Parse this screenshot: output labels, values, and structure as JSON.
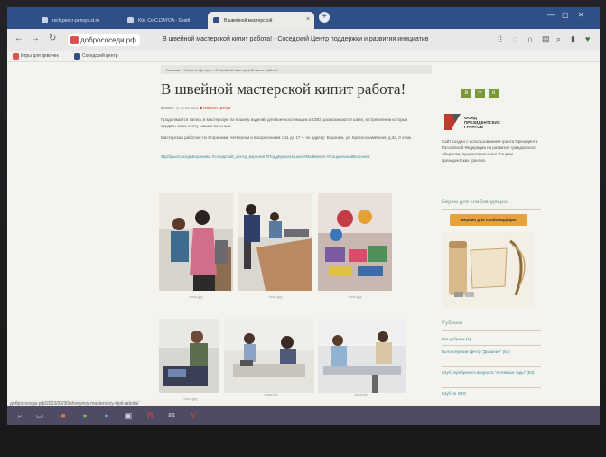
{
  "browser": {
    "tabs": [
      {
        "label": "rsch.peecr-pensys.st.ru"
      },
      {
        "label": "Kto. Co.C.DAYOA - Seattl"
      },
      {
        "label": "В швейной мастерской"
      }
    ],
    "address_chip": "добрососеди.рф",
    "page_heading": "В швейной мастерской кипит работа! - Соседский Центр поддержки и развития инициатив",
    "bookmarks": [
      {
        "label": "Игры для девочек"
      },
      {
        "label": "Соседский центр"
      }
    ]
  },
  "page": {
    "breadcrumb": "Главная » Новости Центра » В швейной мастерской кипит работа!",
    "title": "В швейной мастерской кипит работа!",
    "meta": {
      "author": "admin",
      "date": "30.03.2023",
      "category": "Новости Центра"
    },
    "paragraphs": [
      "Продолжается запись в мастерскую по пошиву изделий для военнослужащих в СВО, разыскиваются швеи, в стремлении которых придать свою лепту нашим военным.",
      "Мастерская работает по вторникам, четвергам и воскресеньям с 11 до 17 ч. по адресу: Воронеж, ул. Краснознамённая, д.3а, 3 этаж."
    ],
    "hashtags": "#ДобрыеСоседиВоронежа #соседский_центр_воронеж #ПоддержкаНаших #МыВместе #СоциальныйВоронеж",
    "photo_caption": "docs.jpg"
  },
  "sidebar": {
    "fund_name": "ФОНД ПРЕЗИДЕНТСКИХ ГРАНТОВ",
    "fund_text": "Сайт создан с использованием гранта Президента Российской Федерации на развитие гражданского общества, предоставленного Фондом президентских грантов.",
    "volunteer_heading": "Берем для слабовидящих",
    "volunteer_button": "Версия для слабовидящих",
    "rubrics_heading": "Рубрики",
    "rubrics": [
      "Без рубрики (4)",
      "Волонтерский Центр \"Дыхание\" (67)",
      "Клуб серебряного возраста \"Активные годы\" (53)",
      "Клуб по ИЗО"
    ]
  },
  "statusbar": {
    "url": "добрососеди.рф/2023/03/30/shveynoy-masterskoy-kipit-rabota/"
  },
  "colors": {
    "tabstrip": "#2f4f87",
    "accent_green": "#7a9a3a",
    "button_orange": "#e8a23b",
    "link_teal": "#3b8a9a",
    "taskbar": "#4f4b62"
  }
}
